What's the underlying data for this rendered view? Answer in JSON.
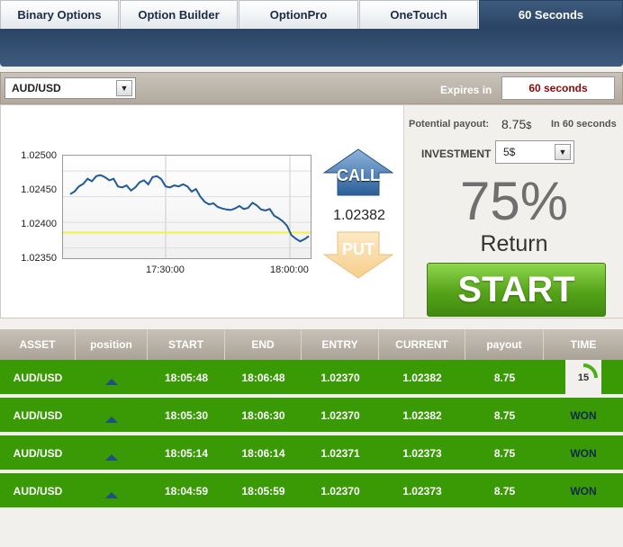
{
  "tabs": [
    {
      "label": "Binary Options",
      "active": false
    },
    {
      "label": "Option Builder",
      "active": false
    },
    {
      "label": "OptionPro",
      "active": false
    },
    {
      "label": "OneTouch",
      "active": false
    },
    {
      "label": "60 Seconds",
      "active": true
    }
  ],
  "controls": {
    "asset": "AUD/USD",
    "expires_label": "Expires in",
    "expires_value": "60 seconds"
  },
  "chart_data": {
    "type": "line",
    "title": "",
    "xlabel": "",
    "ylabel": "",
    "y_ticks": [
      "1.02500",
      "1.02450",
      "1.02400",
      "1.02350"
    ],
    "x_ticks": [
      "17:30:00",
      "18:00:00"
    ],
    "ylim": [
      1.0233,
      1.0253
    ],
    "strike_level": 1.0238,
    "series": [
      {
        "values": [
          1.02455,
          1.0246,
          1.0247,
          1.02475,
          1.02485,
          1.0248,
          1.0249,
          1.02492,
          1.02488,
          1.02482,
          1.02485,
          1.0247,
          1.02468,
          1.02472,
          1.02462,
          1.02468,
          1.02478,
          1.02482,
          1.02474,
          1.02488,
          1.0249,
          1.02484,
          1.0247,
          1.02468,
          1.02472,
          1.0247,
          1.02474,
          1.0247,
          1.0246,
          1.02465,
          1.0245,
          1.0244,
          1.02435,
          1.02437,
          1.0243,
          1.02427,
          1.02425,
          1.02424,
          1.02427,
          1.02432,
          1.02426,
          1.02428,
          1.02438,
          1.02433,
          1.02425,
          1.02423,
          1.02426,
          1.02413,
          1.02408,
          1.02402,
          1.02393,
          1.02375,
          1.02368,
          1.02363,
          1.02367,
          1.02373
        ]
      }
    ]
  },
  "trade": {
    "call_label": "CALL",
    "put_label": "PUT",
    "current_price": "1.02382",
    "payout_label": "Potential payout:",
    "payout_value": "8.75",
    "payout_currency": "$",
    "payout_time": "In 60 seconds",
    "investment_label": "INVESTMENT",
    "investment_value": "5$",
    "return_percent": "75%",
    "return_label": "Return",
    "start_label": "START"
  },
  "table": {
    "headers": [
      "ASSET",
      "position",
      "START",
      "END",
      "ENTRY",
      "CURRENT",
      "payout",
      "TIME"
    ],
    "rows": [
      {
        "asset": "AUD/USD",
        "direction": "up",
        "start": "18:05:48",
        "end": "18:06:48",
        "entry": "1.02370",
        "current": "1.02382",
        "payout": "8.75",
        "time": "15",
        "time_remaining_fraction": 0.25
      },
      {
        "asset": "AUD/USD",
        "direction": "up",
        "start": "18:05:30",
        "end": "18:06:30",
        "entry": "1.02370",
        "current": "1.02382",
        "payout": "8.75",
        "time": "WON"
      },
      {
        "asset": "AUD/USD",
        "direction": "up",
        "start": "18:05:14",
        "end": "18:06:14",
        "entry": "1.02371",
        "current": "1.02373",
        "payout": "8.75",
        "time": "WON"
      },
      {
        "asset": "AUD/USD",
        "direction": "up",
        "start": "18:04:59",
        "end": "18:05:59",
        "entry": "1.02370",
        "current": "1.02373",
        "payout": "8.75",
        "time": "WON"
      }
    ]
  },
  "colors": {
    "tab_active": "#2a4364",
    "row_green": "#3a9a06",
    "start_green": "#55a319",
    "chart_line": "#1f5a99",
    "strike_line": "#f2f24a",
    "expires_text": "#8a0a0a"
  },
  "icons": {
    "call": "up-arrow-icon",
    "put": "down-arrow-icon",
    "position": "up-triangle-icon",
    "dropdown": "chevron-down-icon",
    "timer": "countdown-ring-icon"
  }
}
